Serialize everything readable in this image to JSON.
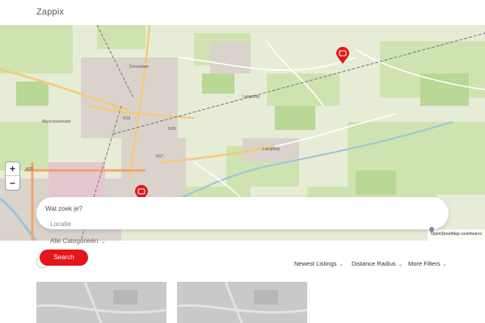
{
  "site": {
    "logo": "Zappix"
  },
  "map": {
    "place_labels": [
      "Dorsselaer",
      "Marschoverveld",
      "Langdorp",
      "Langdorp",
      "N19",
      "N19",
      "N19",
      "N17",
      "A25"
    ],
    "zoom_in": "+",
    "zoom_out": "−",
    "attribution": "OpenStreetMap contributors",
    "markers": [
      "listing-marker-1",
      "listing-marker-2"
    ]
  },
  "search": {
    "what_placeholder": "Wat zoek je?",
    "location_placeholder": "Locatie",
    "category_selected": "Alle Categorieën",
    "button_label": "Search"
  },
  "filters": {
    "sort": "Newest Listings",
    "distance": "Distance Radius",
    "more": "More Filters"
  },
  "colors": {
    "accent": "#e3161a",
    "map_bg": "#e7ecd7",
    "map_green": "#cfe3b0"
  }
}
